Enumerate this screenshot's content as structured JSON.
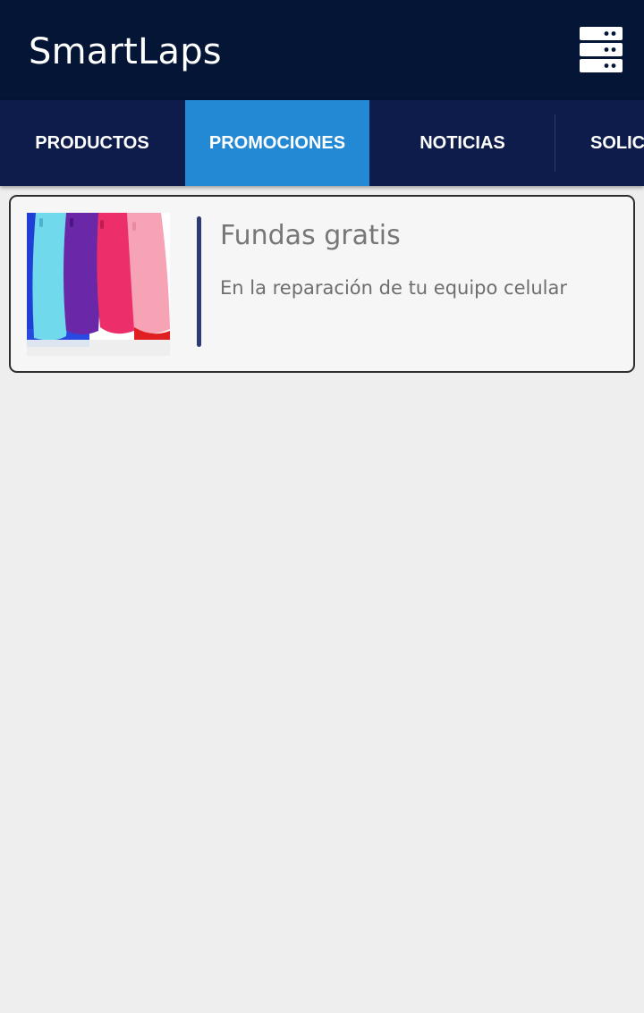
{
  "app": {
    "title": "SmartLaps",
    "menu_icon": "server-menu-icon"
  },
  "tabs": [
    {
      "label": "PRODUCTOS",
      "active": false
    },
    {
      "label": "PROMOCIONES",
      "active": true
    },
    {
      "label": "NOTICIAS",
      "active": false
    },
    {
      "label": "SOLICI",
      "active": false
    }
  ],
  "promotions": [
    {
      "title": "Fundas gratis",
      "description": "En la reparación de tu equipo celular",
      "image": "phone-cases-photo"
    }
  ],
  "colors": {
    "app_bar": "#051535",
    "tab_bar": "#0e1c4c",
    "tab_active": "#2389d4",
    "accent_bar": "#2c3c73",
    "background": "#eeeeee"
  }
}
